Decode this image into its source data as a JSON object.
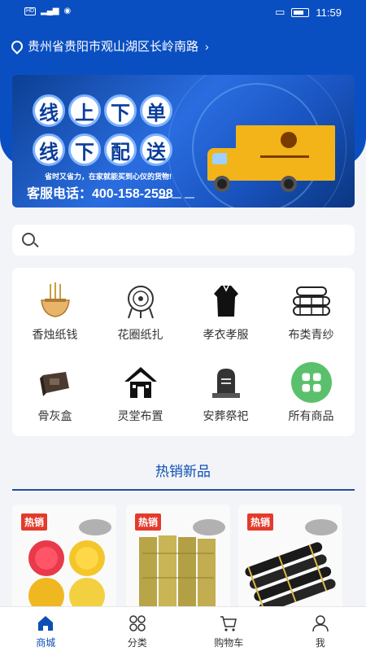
{
  "status_bar": {
    "time": "11:59",
    "battery": "61"
  },
  "location": {
    "address": "贵州省贵阳市观山湖区长岭南路"
  },
  "banner": {
    "row1": [
      "线",
      "上",
      "下",
      "单"
    ],
    "row2": [
      "线",
      "下",
      "配",
      "送"
    ],
    "tagline": "省时又省力，在家就能买到心仪的货物!",
    "phone": "客服电话：400-158-2598"
  },
  "categories": [
    {
      "label": "香烛纸钱",
      "icon": "incense-icon"
    },
    {
      "label": "花圈纸扎",
      "icon": "wreath-icon"
    },
    {
      "label": "孝衣孝服",
      "icon": "mourning-robe-icon"
    },
    {
      "label": "布类青纱",
      "icon": "cloth-rolls-icon"
    },
    {
      "label": "骨灰盒",
      "icon": "urn-icon"
    },
    {
      "label": "灵堂布置",
      "icon": "memorial-hall-icon"
    },
    {
      "label": "安葬祭祀",
      "icon": "tombstone-icon"
    },
    {
      "label": "所有商品",
      "icon": "all-products-icon"
    }
  ],
  "hot_section": {
    "title": "热销新品"
  },
  "products": [
    {
      "tag": "热销"
    },
    {
      "tag": "热销"
    },
    {
      "tag": "热销"
    }
  ],
  "tabbar": [
    {
      "label": "商城",
      "active": true
    },
    {
      "label": "分类",
      "active": false
    },
    {
      "label": "购物车",
      "active": false
    },
    {
      "label": "我",
      "active": false
    }
  ],
  "colors": {
    "primary": "#0a4fc2",
    "accent": "#0d4fb5",
    "hot_tag": "#e23b2c"
  }
}
